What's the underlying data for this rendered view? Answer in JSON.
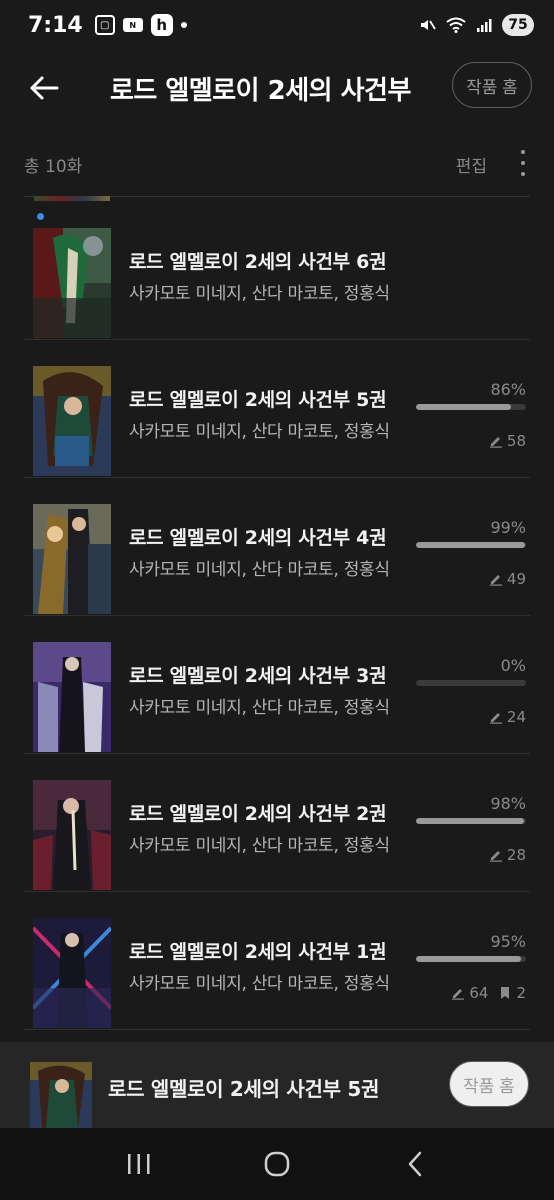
{
  "status_bar": {
    "time": "7:14",
    "battery": "75",
    "icons": [
      "screenshot-icon",
      "nfc-icon",
      "h-app-icon",
      "dot-icon",
      "mute-icon",
      "wifi-icon",
      "signal-icon"
    ],
    "left_glyphs": {
      "pill": "N",
      "h": "h"
    }
  },
  "header": {
    "title": "로드 엘멜로이 2세의 사건부",
    "work_home_label": "작품 홈"
  },
  "subheader": {
    "total_count": "총 10화",
    "edit_label": "편집"
  },
  "books": [
    {
      "title": "로드 엘멜로이 2세의 사건부 6권",
      "authors": "사카모토 미네지, 산다 마코토, 정홍식",
      "is_new": true,
      "progress": null,
      "notes": null,
      "bookmarks": null
    },
    {
      "title": "로드 엘멜로이 2세의 사건부 5권",
      "authors": "사카모토 미네지, 산다 마코토, 정홍식",
      "is_new": false,
      "progress": "86%",
      "progress_value": 86,
      "notes": "58",
      "bookmarks": null
    },
    {
      "title": "로드 엘멜로이 2세의 사건부 4권",
      "authors": "사카모토 미네지, 산다 마코토, 정홍식",
      "is_new": false,
      "progress": "99%",
      "progress_value": 99,
      "notes": "49",
      "bookmarks": null
    },
    {
      "title": "로드 엘멜로이 2세의 사건부 3권",
      "authors": "사카모토 미네지, 산다 마코토, 정홍식",
      "is_new": false,
      "progress": "0%",
      "progress_value": 0,
      "notes": "24",
      "bookmarks": null
    },
    {
      "title": "로드 엘멜로이 2세의 사건부 2권",
      "authors": "사카모토 미네지, 산다 마코토, 정홍식",
      "is_new": false,
      "progress": "98%",
      "progress_value": 98,
      "notes": "28",
      "bookmarks": null
    },
    {
      "title": "로드 엘멜로이 2세의 사건부 1권",
      "authors": "사카모토 미네지, 산다 마코토, 정홍식",
      "is_new": false,
      "progress": "95%",
      "progress_value": 95,
      "notes": "64",
      "bookmarks": "2"
    }
  ],
  "mini_player": {
    "title": "로드 엘멜로이 2세의 사건부 5권",
    "work_home_label": "작품 홈"
  },
  "nav_bar": {
    "buttons": [
      "recent-apps-icon",
      "home-icon",
      "back-icon"
    ]
  },
  "colors": {
    "background": "#1a1a1a",
    "accent_new_dot": "#3b8ee8",
    "progress_fill": "#9a9a9a",
    "progress_track": "#3a3a3a"
  }
}
